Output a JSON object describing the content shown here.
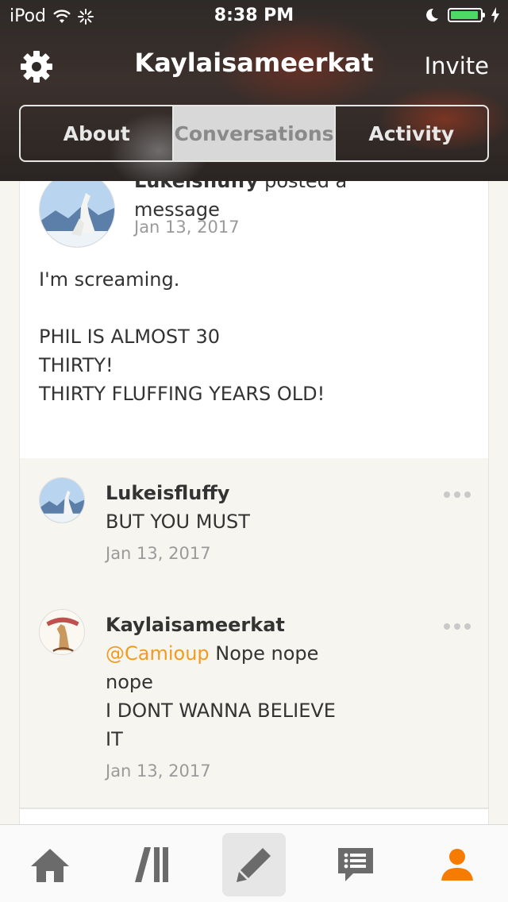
{
  "status_bar": {
    "device": "iPod",
    "time": "8:38 PM"
  },
  "header": {
    "title": "Kaylaisameerkat",
    "invite_label": "Invite"
  },
  "tabs": [
    {
      "label": "About",
      "active": false
    },
    {
      "label": "Conversations",
      "active": true
    },
    {
      "label": "Activity",
      "active": false
    }
  ],
  "post": {
    "author": "Lukeisfluffy",
    "action": "posted a",
    "action_line2": "message",
    "date": "Jan 13, 2017",
    "body": [
      "I'm screaming.",
      "",
      "PHIL IS ALMOST 30",
      "THIRTY!",
      "THIRTY FLUFFING YEARS OLD!"
    ]
  },
  "comments": [
    {
      "author": "Lukeisfluffy",
      "text": "BUT YOU MUST",
      "date": "Jan 13, 2017"
    },
    {
      "author": "Kaylaisameerkat",
      "mention": "@Camioup",
      "text_after_mention": " Nope nope",
      "text_lines": [
        "nope",
        "I DONT WANNA BELIEVE",
        "IT"
      ],
      "date": "Jan 13, 2017"
    }
  ],
  "tabbar": {
    "items": [
      {
        "icon": "home-icon"
      },
      {
        "icon": "library-icon"
      },
      {
        "icon": "pencil-icon"
      },
      {
        "icon": "chat-icon"
      },
      {
        "icon": "profile-icon"
      }
    ],
    "active_color": "#f57c00",
    "inactive_color": "#6b6b6b"
  },
  "colors": {
    "accent": "#f29b1e",
    "battery": "#4cd964"
  }
}
